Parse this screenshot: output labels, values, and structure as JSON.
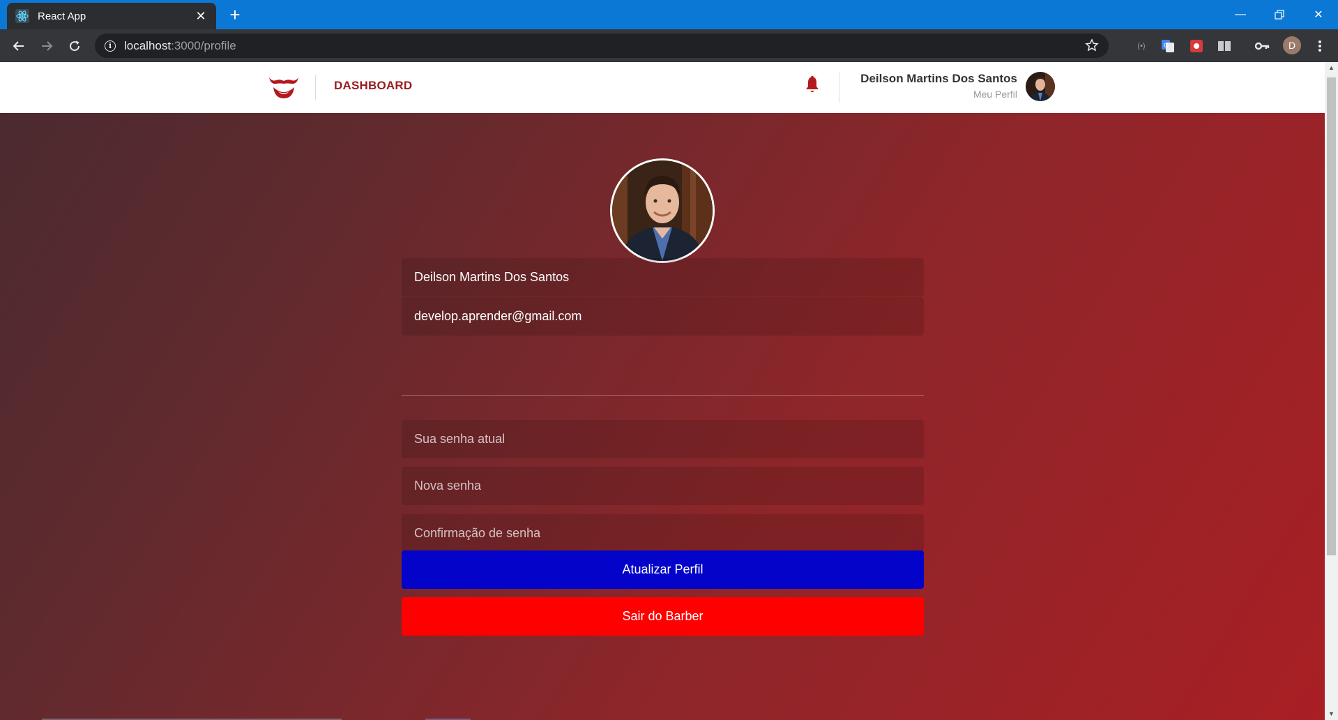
{
  "browser": {
    "tab_title": "React App",
    "url_host": "localhost",
    "url_path": ":3000/profile",
    "profile_initial": "D"
  },
  "header": {
    "nav_link": "DASHBOARD",
    "user_name": "Deilson Martins Dos Santos",
    "user_subtitle": "Meu Perfil"
  },
  "form": {
    "name_value": "Deilson Martins Dos Santos",
    "email_value": "develop.aprender@gmail.com",
    "old_password_placeholder": "Sua senha atual",
    "new_password_placeholder": "Nova senha",
    "confirm_password_placeholder": "Confirmação de senha",
    "submit_label": "Atualizar Perfil",
    "logout_label": "Sair do Barber"
  },
  "colors": {
    "brand": "#9a1c1f",
    "update_button": "#0303c9",
    "logout_button": "#ff0000",
    "tab_bar": "#0b78d5"
  }
}
